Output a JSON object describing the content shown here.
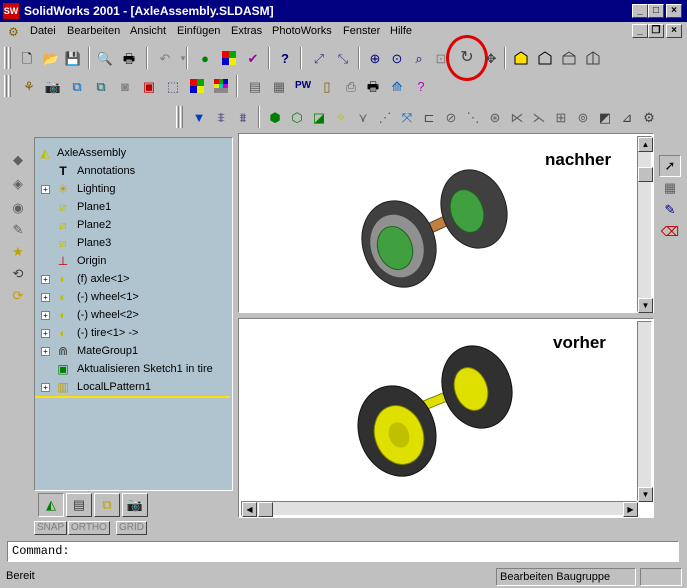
{
  "window": {
    "app_icon": "SW",
    "title": "SolidWorks 2001 - [AxleAssembly.SLDASM]",
    "caption_buttons": [
      "_",
      "□",
      "×"
    ],
    "mdi_buttons": [
      "_",
      "❐",
      "×"
    ]
  },
  "menu": {
    "items": [
      "Datei",
      "Bearbeiten",
      "Ansicht",
      "Einfügen",
      "Extras",
      "PhotoWorks",
      "Fenster",
      "Hilfe"
    ]
  },
  "toolbars": {
    "standard": [
      "new-icon",
      "open-icon",
      "save-icon",
      "print-preview-icon",
      "print-icon",
      "undo-icon",
      "traffic-light-icon",
      "rebuild-colors-icon",
      "options-icon",
      "help-icon",
      "select-icon",
      "smart-select-icon",
      "zoom-fit-icon",
      "zoom-in-icon",
      "zoom-window-icon",
      "pan-icon",
      "rotate-icon",
      "move-icon",
      "view-shaded-icon",
      "view-hidden-icon",
      "view-wire-icon",
      "view-iso-icon"
    ],
    "photoworks": [
      "render-icon",
      "camera-icon",
      "copy-icon",
      "camera2-icon",
      "material-icon",
      "palette-icon",
      "scene-icon",
      "save-image-icon",
      "decal-icon",
      "lights-icon",
      "print-render-icon",
      "options-render-icon",
      "export-icon",
      "help-render-icon"
    ],
    "assembly": [
      "filter-icon",
      "filter-edge-icon",
      "filter-face-icon",
      "mate-coincident-icon",
      "mate-parallel-icon",
      "mate-perp-icon",
      "mate-tangent-icon",
      "mate-concentric-icon",
      "mate-distance-icon",
      "mate-angle-icon",
      "mate-align-icon",
      "mate-anti-icon",
      "mate-closest-icon",
      "mate-sym-icon",
      "mate-path-icon",
      "mate-lock-icon",
      "mate-width-icon",
      "mate-cam-icon",
      "mate-gear-icon",
      "mate-rack-icon"
    ]
  },
  "feature_tree": {
    "root": "AxleAssembly",
    "items": [
      {
        "label": "Annotations",
        "icon": "annotations-icon",
        "expandable": false
      },
      {
        "label": "Lighting",
        "icon": "lighting-icon",
        "expandable": true
      },
      {
        "label": "Plane1",
        "icon": "plane-icon",
        "expandable": false
      },
      {
        "label": "Plane2",
        "icon": "plane-icon",
        "expandable": false
      },
      {
        "label": "Plane3",
        "icon": "plane-icon",
        "expandable": false
      },
      {
        "label": "Origin",
        "icon": "origin-icon",
        "expandable": false
      },
      {
        "label": "(f) axle<1>",
        "icon": "part-icon",
        "expandable": true
      },
      {
        "label": "(-) wheel<1>",
        "icon": "part-icon",
        "expandable": true
      },
      {
        "label": "(-) wheel<2>",
        "icon": "part-icon",
        "expandable": true
      },
      {
        "label": "(-) tire<1> ->",
        "icon": "part-icon",
        "expandable": true
      },
      {
        "label": "MateGroup1",
        "icon": "mategroup-icon",
        "expandable": true
      },
      {
        "label": "Aktualisieren Sketch1 in tire",
        "icon": "sketch-icon",
        "expandable": false
      },
      {
        "label": "LocalLPattern1",
        "icon": "pattern-icon",
        "expandable": true
      }
    ],
    "tabs": [
      "featuremanager-icon",
      "property-icon",
      "configuration-icon",
      "photoworks-tab-icon"
    ]
  },
  "snap_buttons": [
    "SNAP",
    "ORTHO",
    "GRID"
  ],
  "viewports": {
    "top": {
      "label": "nachher",
      "axle_color": "#c08040",
      "hub_color": "#40a040"
    },
    "bottom": {
      "label": "vorher",
      "axle_color": "#e0e000",
      "hub_color": "#e0e000"
    }
  },
  "command": {
    "text": "Command:"
  },
  "status": {
    "left": "Bereit",
    "right": "Bearbeiten Baugruppe"
  },
  "colors": {
    "title_bg": "#000080",
    "tree_bg": "#b0c4d0",
    "highlight": "#e00000",
    "rollback": "#ffe000"
  }
}
